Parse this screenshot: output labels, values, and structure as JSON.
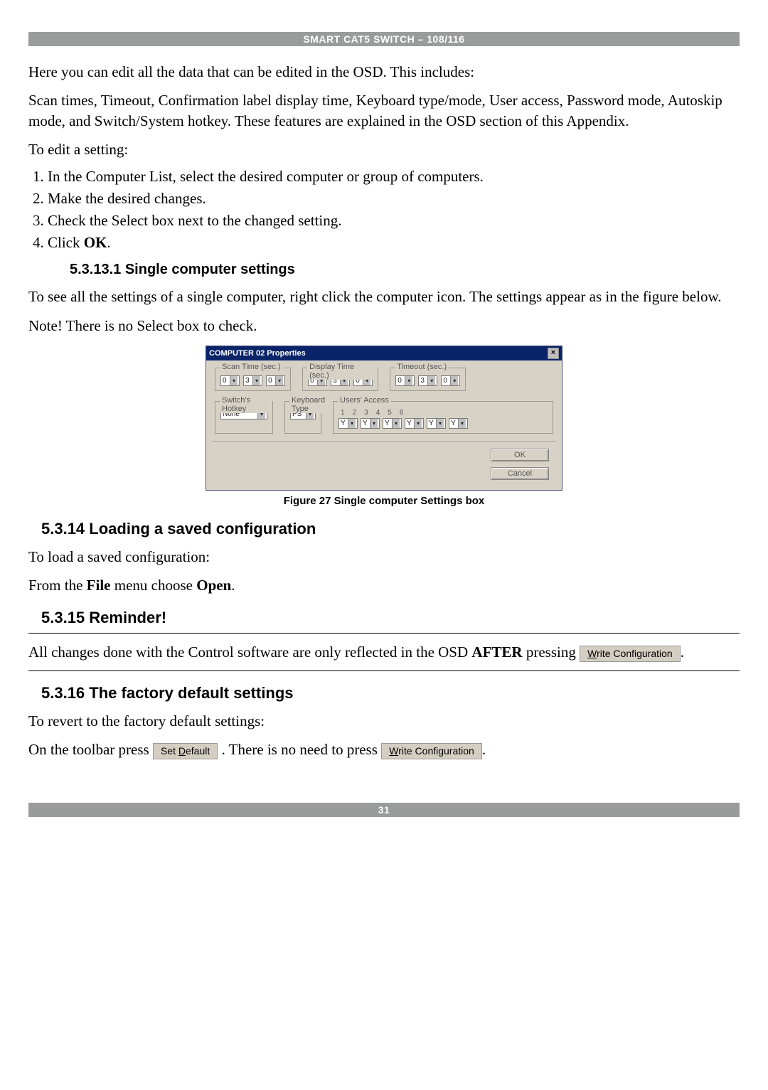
{
  "header": "SMART CAT5 SWITCH – 108/116",
  "intro": "Here you can edit all the data that can be edited in the OSD. This includes:",
  "description": "Scan times, Timeout, Confirmation label display time, Keyboard type/mode, User access, Password mode, Autoskip mode, and Switch/System hotkey. These features are explained in the OSD section of this Appendix.",
  "to_edit": "To edit a setting:",
  "steps": {
    "s1": "1.  In the Computer List, select the desired computer or group of computers.",
    "s2": "2.  Make the desired changes.",
    "s3": "3.  Check the Select box next to the changed setting.",
    "s4_pre": "4.  Click ",
    "s4_bold": "OK",
    "s4_post": "."
  },
  "h_single": "5.3.13.1 Single computer settings",
  "single_p": "To see all the settings of a single computer, right click the computer icon. The settings appear as in the figure below.",
  "note": "Note! There is no Select box to check.",
  "dialog": {
    "title": "COMPUTER 02 Properties",
    "scan": "Scan Time (sec.)",
    "display": "Display Time (sec.)",
    "timeout": "Timeout (sec.)",
    "switchkey": "Switch's Hotkey",
    "kbdtype": "Keyboard Type",
    "useraccess": "Users' Access",
    "none": "None",
    "ps": "PS",
    "zero": "0",
    "three": "3",
    "y": "Y",
    "u1": "1",
    "u2": "2",
    "u3": "3",
    "u4": "4",
    "u5": "5",
    "u6": "6",
    "ok": "OK",
    "cancel": "Cancel"
  },
  "fig_caption": "Figure 27 Single computer Settings box",
  "h_load": "5.3.14 Loading a saved configuration",
  "load_p": "To load a saved configuration:",
  "from_pre": "From the ",
  "file": "File",
  "from_mid": " menu choose ",
  "open": "Open",
  "from_post": ".",
  "h_reminder": "5.3.15 Reminder!",
  "reminder_pre": "All changes done with the Control software are only reflected in the OSD ",
  "reminder_after": "AFTER",
  "reminder_mid": " pressing ",
  "write_conf_pre": "W",
  "write_conf_post": "rite Configuration",
  "reminder_post": ".",
  "h_factory": "5.3.16 The factory default settings",
  "factory_p": "To revert to the factory default settings:",
  "toolbar_pre": "On the toolbar press ",
  "set_default_pre": "Set ",
  "set_default_u": "D",
  "set_default_post": "efault",
  "toolbar_mid": ". There is no need to press ",
  "toolbar_post": ".",
  "page_no": "31"
}
